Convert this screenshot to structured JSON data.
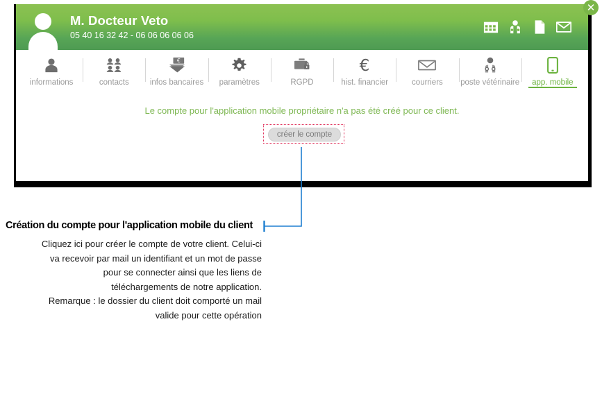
{
  "window": {
    "header": {
      "avatar_icon": "user-avatar-icon",
      "client_name": "M. Docteur Veto",
      "client_phones": "05 40 16 32 42 - 06 06 06 06 06",
      "close_label": "✕",
      "actions": [
        {
          "name": "calendar-grid-icon",
          "label": "agenda"
        },
        {
          "name": "veterinarian-person-icon",
          "label": "praticien"
        },
        {
          "name": "document-page-icon",
          "label": "document"
        },
        {
          "name": "envelope-mail-icon",
          "label": "courrier"
        }
      ]
    },
    "tabs": [
      {
        "label": "informations",
        "icon": "person-icon",
        "active": false
      },
      {
        "label": "contacts",
        "icon": "people-group-icon",
        "active": false
      },
      {
        "label": "infos bancaires",
        "icon": "euro-card-icon",
        "active": false
      },
      {
        "label": "paramètres",
        "icon": "gear-icon",
        "active": false
      },
      {
        "label": "RGPD",
        "icon": "briefcase-lock-icon",
        "active": false
      },
      {
        "label": "hist. financier",
        "icon": "euro-sign-icon",
        "active": false
      },
      {
        "label": "courriers",
        "icon": "envelope-icon",
        "active": false
      },
      {
        "label": "poste vétérinaire",
        "icon": "vet-stethoscope-icon",
        "active": false
      },
      {
        "label": "app. mobile",
        "icon": "smartphone-icon",
        "active": true
      }
    ],
    "content": {
      "empty_message": "Le compte pour l'application mobile propriétaire n'a pas été créé pour ce client.",
      "create_button_label": "créer le compte"
    }
  },
  "callout": {
    "title": "Création du compte pour l'application mobile du client",
    "body_lines": [
      "Cliquez ici pour créer le compte de votre client. Celui-ci",
      "va recevoir par mail un identifiant et un mot de passe",
      "pour se connecter ainsi que les liens de",
      "téléchargements de notre application.",
      "Remarque : le dossier du client doit comporté un mail",
      "valide pour cette opération"
    ]
  },
  "colors": {
    "header_green_top": "#8cc152",
    "header_green_bottom": "#4e9a52",
    "accent_green": "#6cb33f",
    "message_green": "#7fb854",
    "annotation_red": "#e0305a",
    "connector_blue": "#1f7fd0",
    "tab_label_gray": "#9a9a9a"
  }
}
